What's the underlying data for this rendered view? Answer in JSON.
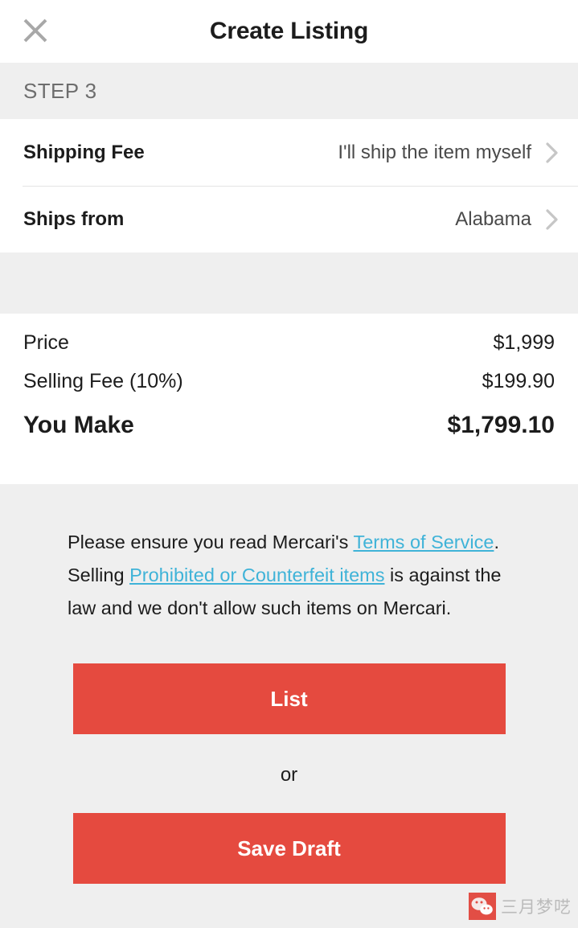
{
  "header": {
    "title": "Create Listing",
    "close_icon": "close-icon"
  },
  "step_banner": {
    "label": "STEP 3"
  },
  "options": [
    {
      "label": "Shipping Fee",
      "value": "I'll ship the item myself",
      "chevron_icon": "chevron-right-icon"
    },
    {
      "label": "Ships from",
      "value": "Alabama",
      "chevron_icon": "chevron-right-icon"
    }
  ],
  "price_summary": [
    {
      "label": "Price",
      "value": "$1,999",
      "emphasis": false
    },
    {
      "label": "Selling Fee (10%)",
      "value": "$199.90",
      "emphasis": false
    },
    {
      "label": "You Make",
      "value": "$1,799.10",
      "emphasis": true
    }
  ],
  "legal": {
    "part1": "Please ensure you read Mercari's ",
    "link1": "Terms of Service",
    "part2": ". Selling ",
    "link2": "Prohibited or Counterfeit items",
    "part3": " is against the law and we don't allow such items on Mercari."
  },
  "actions": {
    "primary_label": "List",
    "or_label": "or",
    "secondary_label": "Save Draft"
  },
  "watermark": {
    "text": "三月梦呓",
    "logo_icon": "wechat-icon"
  },
  "colors": {
    "accent_red": "#e54a3f",
    "link_blue": "#3fb3d8",
    "panel_gray": "#efefef",
    "text_dark": "#1c1c1c"
  }
}
